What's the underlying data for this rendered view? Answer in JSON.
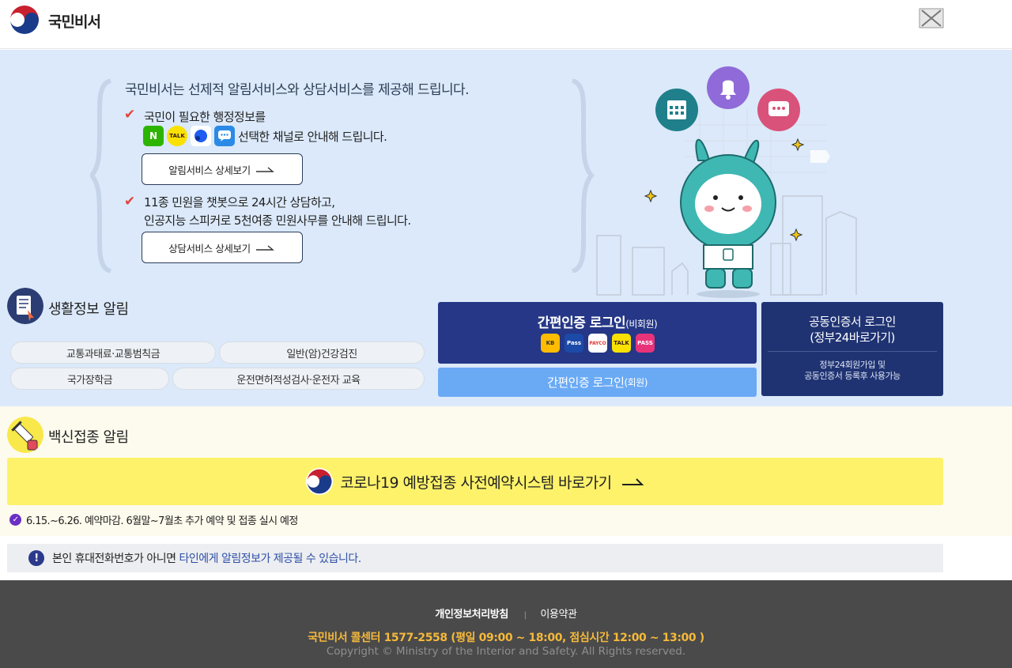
{
  "header": {
    "brand": "국민비서",
    "close_icon": "close-icon"
  },
  "hero": {
    "intro": "국민비서는 선제적 알림서비스와 상담서비스를 제공해 드립니다.",
    "feature1_line1": "국민이 필요한 행정정보를",
    "feature1_line2": "선택한 채널로 안내해 드립니다.",
    "channels": [
      "N",
      "TALK",
      "",
      ""
    ],
    "btn_notify": "알림서비스 상세보기",
    "feature2_line1": "11종 민원을 챗봇으로 24시간 상담하고,",
    "feature2_line2": "인공지능 스피커로 5천여종 민원사무를 안내해 드립니다.",
    "btn_consult": "상담서비스 상세보기"
  },
  "life": {
    "title": "생활정보 알림",
    "items": [
      "교통과태료·교통범칙금",
      "일반(암)건강검진",
      "국가장학금",
      "운전면허적성검사·운전자 교육"
    ]
  },
  "login": {
    "simple_main": "간편인증 로그인",
    "simple_main_sub": "(비회원)",
    "auth_badges": [
      "KB",
      "Pass",
      "PAYCO",
      "TALK",
      "PASS"
    ],
    "simple_member": "간편인증 로그인",
    "simple_member_sub": "(회원)",
    "cert_line1": "공동인증서 로그인",
    "cert_line2": "(정부24바로가기)",
    "cert_note1": "정부24회원가입 및",
    "cert_note2": "공동인증서 등록후 사용가능"
  },
  "vaccine": {
    "title": "백신접종 알림",
    "button": "코로나19 예방접종 사전예약시스템 바로가기",
    "note": "6.15.~6.26. 예약마감. 6월말~7월초 추가 예약 및 접종 실시 예정"
  },
  "warning": {
    "prefix": "본인 휴대전화번호가 아니면",
    "highlight": "타인에게 알림정보가 제공될 수 있습니다."
  },
  "footer": {
    "privacy": "개인정보처리방침",
    "terms": "이용약관",
    "callcenter": "국민비서 콜센터 1577-2558 (평일 09:00 ~ 18:00, 점심시간 12:00 ~ 13:00 )",
    "copyright": "Copyright © Ministry of the Interior and Safety. All Rights reserved."
  },
  "colors": {
    "navy": "#253786",
    "hero_bg": "#dbe9fa",
    "vaccine_yellow": "#fdf26a",
    "footer_bg": "#4a4a4a",
    "accent_orange": "#f6b93a"
  }
}
